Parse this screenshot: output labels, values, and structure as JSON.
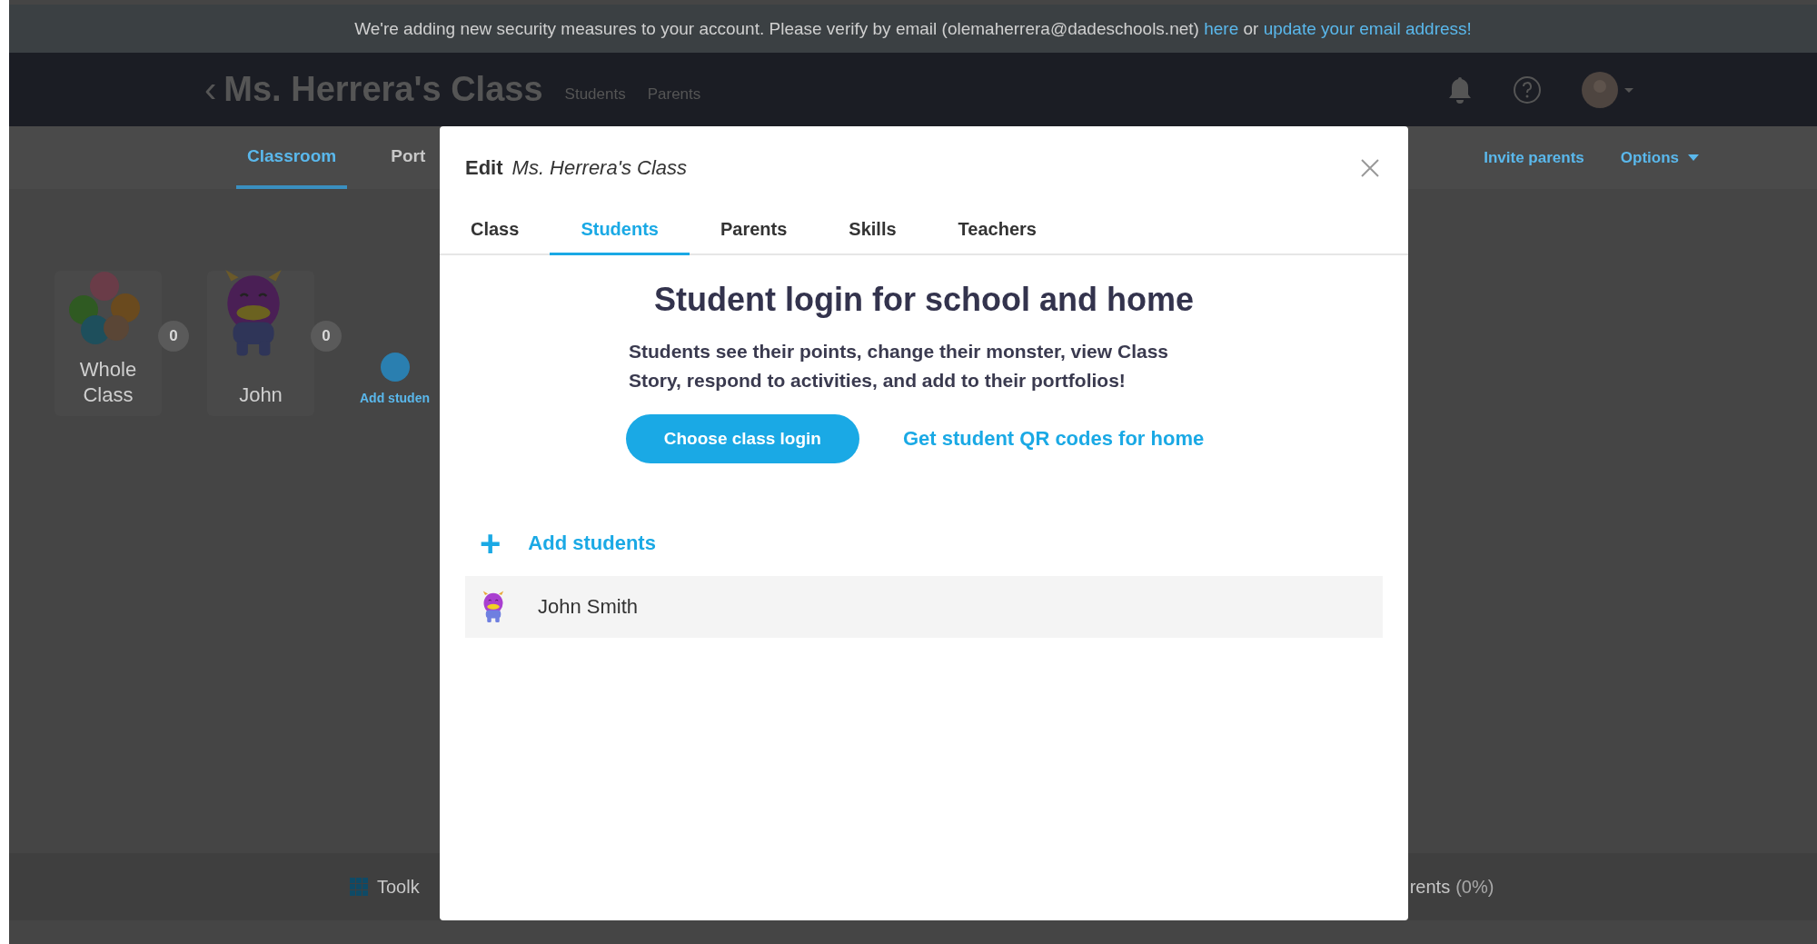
{
  "banner": {
    "text": "We're adding new security measures to your account. Please verify by email (olemaherrera@dadeschools.net) ",
    "link_1": "here",
    "joiner": " or ",
    "link_2": "update your email address!"
  },
  "header": {
    "back": "‹",
    "title": "Ms. Herrera's Class",
    "links": [
      "Students",
      "Parents"
    ]
  },
  "subnav": {
    "tabs": [
      {
        "label": "Classroom",
        "selected": true
      },
      {
        "label": "Port",
        "selected": false
      }
    ],
    "actions": [
      "Invite parents",
      "Options"
    ]
  },
  "students": [
    {
      "kind": "group",
      "name": "Whole Class",
      "points": "0"
    },
    {
      "kind": "monster",
      "name": "John",
      "points": "0"
    }
  ],
  "add_student": "Add studen",
  "bottom_bar": {
    "items": [
      "Toolk",
      "rents"
    ],
    "percent": "(0%)"
  },
  "modal": {
    "title_prefix": "Edit",
    "title": "Ms. Herrera's Class",
    "tabs": [
      {
        "label": "Class",
        "selected": false
      },
      {
        "label": "Students",
        "selected": true
      },
      {
        "label": "Parents",
        "selected": false
      },
      {
        "label": "Skills",
        "selected": false
      },
      {
        "label": "Teachers",
        "selected": false
      }
    ],
    "heading": "Student login for school and home",
    "description": "Students see their points, change their monster, view Class Story, respond to activities, and add to their portfolios!",
    "primary_button": "Choose class login",
    "qr_link": "Get student QR codes for home",
    "add_students": {
      "icon": "+",
      "label": "Add students"
    },
    "student_rows": [
      {
        "name": "John Smith"
      }
    ]
  }
}
